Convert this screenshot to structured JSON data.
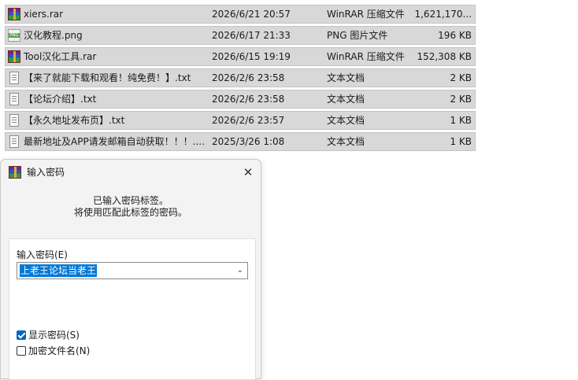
{
  "files": [
    {
      "icon": "rar-archive-icon",
      "name": "xiers.rar",
      "date": "2026/6/21 20:57",
      "type": "WinRAR 压缩文件",
      "size": "1,621,170..."
    },
    {
      "icon": "png-image-icon",
      "name": "汉化教程.png",
      "date": "2026/6/17 21:33",
      "type": "PNG 图片文件",
      "size": "196 KB"
    },
    {
      "icon": "rar-archive-icon",
      "name": "Tool汉化工具.rar",
      "date": "2026/6/15 19:19",
      "type": "WinRAR 压缩文件",
      "size": "152,308 KB"
    },
    {
      "icon": "text-document-icon",
      "name": "【来了就能下载和观看！纯免费！】.txt",
      "date": "2026/2/6 23:58",
      "type": "文本文档",
      "size": "2 KB"
    },
    {
      "icon": "text-document-icon",
      "name": "【论坛介绍】.txt",
      "date": "2026/2/6 23:58",
      "type": "文本文档",
      "size": "2 KB"
    },
    {
      "icon": "text-document-icon",
      "name": "【永久地址发布页】.txt",
      "date": "2026/2/6 23:57",
      "type": "文本文档",
      "size": "1 KB"
    },
    {
      "icon": "text-document-icon",
      "name": "最新地址及APP请发邮箱自动获取！！！....",
      "date": "2025/3/26 1:08",
      "type": "文本文档",
      "size": "1 KB"
    }
  ],
  "dialog": {
    "icon": "winrar-icon",
    "title": "输入密码",
    "close_glyph": "✕",
    "message_line1": "已输入密码标签。",
    "message_line2": "将使用匹配此标签的密码。",
    "password_label": "输入密码(E)",
    "password_value": "上老王论坛当老王",
    "show_password_label": "显示密码(S)",
    "show_password_checked": true,
    "encrypt_filenames_label": "加密文件名(N)",
    "encrypt_filenames_checked": false
  },
  "colors": {
    "selection": "#0078d7",
    "row_bg": "#d8d8d8",
    "checkbox_accent": "#0067c0"
  }
}
